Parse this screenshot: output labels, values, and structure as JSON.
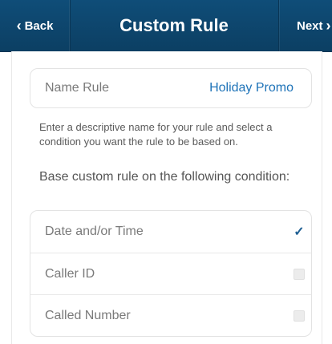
{
  "nav": {
    "back_label": "Back",
    "title": "Custom Rule",
    "next_label": "Next",
    "back_icon": "chevron-left-icon",
    "next_icon": "chevron-right-icon",
    "bar_color": "#0f4d78"
  },
  "name_rule": {
    "label": "Name Rule",
    "value": "Holiday Promo",
    "value_color": "#1e73b8"
  },
  "helper_text": "Enter a descriptive name for your rule and select a condition you want the rule to be based on.",
  "section_label": "Base custom rule on the following condition:",
  "conditions": [
    {
      "label": "Date and/or Time",
      "checked": true
    },
    {
      "label": "Caller ID",
      "checked": false
    },
    {
      "label": "Called Number",
      "checked": false
    }
  ]
}
